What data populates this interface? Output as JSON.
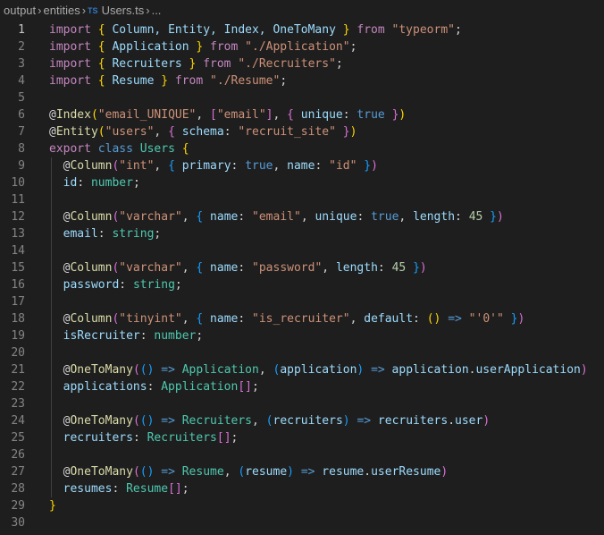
{
  "breadcrumb": {
    "items": [
      "output",
      "entities",
      "Users.ts",
      "..."
    ],
    "file_icon": "TS"
  },
  "editor": {
    "active_line": 1,
    "theme_colors": {
      "keyword_blue": "#569cd6",
      "keyword_purple": "#c586c0",
      "string": "#ce9178",
      "number": "#b5cea8",
      "type_teal": "#4ec9b0",
      "variable": "#9cdcfe",
      "function": "#dcdcaa",
      "bracket_gold": "#ffd700",
      "bracket_purple": "#da70d6",
      "bracket_blue": "#179fff",
      "text": "#d4d4d4",
      "line_number": "#858585"
    },
    "lines": [
      {
        "num": "1",
        "tokens": [
          [
            "import",
            "#c586c0"
          ],
          [
            " ",
            "#d4d4d4"
          ],
          [
            "{",
            "#ffd700"
          ],
          [
            " Column, Entity, Index, OneToMany ",
            "#9cdcfe"
          ],
          [
            "}",
            "#ffd700"
          ],
          [
            " ",
            "#d4d4d4"
          ],
          [
            "from",
            "#c586c0"
          ],
          [
            " ",
            "#d4d4d4"
          ],
          [
            "\"typeorm\"",
            "#ce9178"
          ],
          [
            ";",
            "#d4d4d4"
          ]
        ]
      },
      {
        "num": "2",
        "tokens": [
          [
            "import",
            "#c586c0"
          ],
          [
            " ",
            "#d4d4d4"
          ],
          [
            "{",
            "#ffd700"
          ],
          [
            " Application ",
            "#9cdcfe"
          ],
          [
            "}",
            "#ffd700"
          ],
          [
            " ",
            "#d4d4d4"
          ],
          [
            "from",
            "#c586c0"
          ],
          [
            " ",
            "#d4d4d4"
          ],
          [
            "\"./Application\"",
            "#ce9178"
          ],
          [
            ";",
            "#d4d4d4"
          ]
        ]
      },
      {
        "num": "3",
        "tokens": [
          [
            "import",
            "#c586c0"
          ],
          [
            " ",
            "#d4d4d4"
          ],
          [
            "{",
            "#ffd700"
          ],
          [
            " Recruiters ",
            "#9cdcfe"
          ],
          [
            "}",
            "#ffd700"
          ],
          [
            " ",
            "#d4d4d4"
          ],
          [
            "from",
            "#c586c0"
          ],
          [
            " ",
            "#d4d4d4"
          ],
          [
            "\"./Recruiters\"",
            "#ce9178"
          ],
          [
            ";",
            "#d4d4d4"
          ]
        ]
      },
      {
        "num": "4",
        "tokens": [
          [
            "import",
            "#c586c0"
          ],
          [
            " ",
            "#d4d4d4"
          ],
          [
            "{",
            "#ffd700"
          ],
          [
            " Resume ",
            "#9cdcfe"
          ],
          [
            "}",
            "#ffd700"
          ],
          [
            " ",
            "#d4d4d4"
          ],
          [
            "from",
            "#c586c0"
          ],
          [
            " ",
            "#d4d4d4"
          ],
          [
            "\"./Resume\"",
            "#ce9178"
          ],
          [
            ";",
            "#d4d4d4"
          ]
        ]
      },
      {
        "num": "5",
        "tokens": []
      },
      {
        "num": "6",
        "tokens": [
          [
            "@",
            "#d4d4d4"
          ],
          [
            "Index",
            "#dcdcaa"
          ],
          [
            "(",
            "#ffd700"
          ],
          [
            "\"email_UNIQUE\"",
            "#ce9178"
          ],
          [
            ", ",
            "#d4d4d4"
          ],
          [
            "[",
            "#da70d6"
          ],
          [
            "\"email\"",
            "#ce9178"
          ],
          [
            "]",
            "#da70d6"
          ],
          [
            ", ",
            "#d4d4d4"
          ],
          [
            "{",
            "#da70d6"
          ],
          [
            " ",
            "#d4d4d4"
          ],
          [
            "unique",
            "#9cdcfe"
          ],
          [
            ": ",
            "#d4d4d4"
          ],
          [
            "true",
            "#569cd6"
          ],
          [
            " ",
            "#d4d4d4"
          ],
          [
            "}",
            "#da70d6"
          ],
          [
            ")",
            "#ffd700"
          ]
        ]
      },
      {
        "num": "7",
        "tokens": [
          [
            "@",
            "#d4d4d4"
          ],
          [
            "Entity",
            "#dcdcaa"
          ],
          [
            "(",
            "#ffd700"
          ],
          [
            "\"users\"",
            "#ce9178"
          ],
          [
            ", ",
            "#d4d4d4"
          ],
          [
            "{",
            "#da70d6"
          ],
          [
            " ",
            "#d4d4d4"
          ],
          [
            "schema",
            "#9cdcfe"
          ],
          [
            ": ",
            "#d4d4d4"
          ],
          [
            "\"recruit_site\"",
            "#ce9178"
          ],
          [
            " ",
            "#d4d4d4"
          ],
          [
            "}",
            "#da70d6"
          ],
          [
            ")",
            "#ffd700"
          ]
        ]
      },
      {
        "num": "8",
        "tokens": [
          [
            "export",
            "#c586c0"
          ],
          [
            " ",
            "#d4d4d4"
          ],
          [
            "class",
            "#569cd6"
          ],
          [
            " ",
            "#d4d4d4"
          ],
          [
            "Users",
            "#4ec9b0"
          ],
          [
            " ",
            "#d4d4d4"
          ],
          [
            "{",
            "#ffd700"
          ]
        ]
      },
      {
        "num": "9",
        "tokens": [
          [
            "  @",
            "#d4d4d4"
          ],
          [
            "Column",
            "#dcdcaa"
          ],
          [
            "(",
            "#da70d6"
          ],
          [
            "\"int\"",
            "#ce9178"
          ],
          [
            ", ",
            "#d4d4d4"
          ],
          [
            "{",
            "#179fff"
          ],
          [
            " ",
            "#d4d4d4"
          ],
          [
            "primary",
            "#9cdcfe"
          ],
          [
            ": ",
            "#d4d4d4"
          ],
          [
            "true",
            "#569cd6"
          ],
          [
            ", ",
            "#d4d4d4"
          ],
          [
            "name",
            "#9cdcfe"
          ],
          [
            ": ",
            "#d4d4d4"
          ],
          [
            "\"id\"",
            "#ce9178"
          ],
          [
            " ",
            "#d4d4d4"
          ],
          [
            "}",
            "#179fff"
          ],
          [
            ")",
            "#da70d6"
          ]
        ]
      },
      {
        "num": "10",
        "tokens": [
          [
            "  ",
            "#d4d4d4"
          ],
          [
            "id",
            "#9cdcfe"
          ],
          [
            ": ",
            "#d4d4d4"
          ],
          [
            "number",
            "#4ec9b0"
          ],
          [
            ";",
            "#d4d4d4"
          ]
        ]
      },
      {
        "num": "11",
        "tokens": []
      },
      {
        "num": "12",
        "tokens": [
          [
            "  @",
            "#d4d4d4"
          ],
          [
            "Column",
            "#dcdcaa"
          ],
          [
            "(",
            "#da70d6"
          ],
          [
            "\"varchar\"",
            "#ce9178"
          ],
          [
            ", ",
            "#d4d4d4"
          ],
          [
            "{",
            "#179fff"
          ],
          [
            " ",
            "#d4d4d4"
          ],
          [
            "name",
            "#9cdcfe"
          ],
          [
            ": ",
            "#d4d4d4"
          ],
          [
            "\"email\"",
            "#ce9178"
          ],
          [
            ", ",
            "#d4d4d4"
          ],
          [
            "unique",
            "#9cdcfe"
          ],
          [
            ": ",
            "#d4d4d4"
          ],
          [
            "true",
            "#569cd6"
          ],
          [
            ", ",
            "#d4d4d4"
          ],
          [
            "length",
            "#9cdcfe"
          ],
          [
            ": ",
            "#d4d4d4"
          ],
          [
            "45",
            "#b5cea8"
          ],
          [
            " ",
            "#d4d4d4"
          ],
          [
            "}",
            "#179fff"
          ],
          [
            ")",
            "#da70d6"
          ]
        ]
      },
      {
        "num": "13",
        "tokens": [
          [
            "  ",
            "#d4d4d4"
          ],
          [
            "email",
            "#9cdcfe"
          ],
          [
            ": ",
            "#d4d4d4"
          ],
          [
            "string",
            "#4ec9b0"
          ],
          [
            ";",
            "#d4d4d4"
          ]
        ]
      },
      {
        "num": "14",
        "tokens": []
      },
      {
        "num": "15",
        "tokens": [
          [
            "  @",
            "#d4d4d4"
          ],
          [
            "Column",
            "#dcdcaa"
          ],
          [
            "(",
            "#da70d6"
          ],
          [
            "\"varchar\"",
            "#ce9178"
          ],
          [
            ", ",
            "#d4d4d4"
          ],
          [
            "{",
            "#179fff"
          ],
          [
            " ",
            "#d4d4d4"
          ],
          [
            "name",
            "#9cdcfe"
          ],
          [
            ": ",
            "#d4d4d4"
          ],
          [
            "\"password\"",
            "#ce9178"
          ],
          [
            ", ",
            "#d4d4d4"
          ],
          [
            "length",
            "#9cdcfe"
          ],
          [
            ": ",
            "#d4d4d4"
          ],
          [
            "45",
            "#b5cea8"
          ],
          [
            " ",
            "#d4d4d4"
          ],
          [
            "}",
            "#179fff"
          ],
          [
            ")",
            "#da70d6"
          ]
        ]
      },
      {
        "num": "16",
        "tokens": [
          [
            "  ",
            "#d4d4d4"
          ],
          [
            "password",
            "#9cdcfe"
          ],
          [
            ": ",
            "#d4d4d4"
          ],
          [
            "string",
            "#4ec9b0"
          ],
          [
            ";",
            "#d4d4d4"
          ]
        ]
      },
      {
        "num": "17",
        "tokens": []
      },
      {
        "num": "18",
        "tokens": [
          [
            "  @",
            "#d4d4d4"
          ],
          [
            "Column",
            "#dcdcaa"
          ],
          [
            "(",
            "#da70d6"
          ],
          [
            "\"tinyint\"",
            "#ce9178"
          ],
          [
            ", ",
            "#d4d4d4"
          ],
          [
            "{",
            "#179fff"
          ],
          [
            " ",
            "#d4d4d4"
          ],
          [
            "name",
            "#9cdcfe"
          ],
          [
            ": ",
            "#d4d4d4"
          ],
          [
            "\"is_recruiter\"",
            "#ce9178"
          ],
          [
            ", ",
            "#d4d4d4"
          ],
          [
            "default",
            "#9cdcfe"
          ],
          [
            ": ",
            "#d4d4d4"
          ],
          [
            "()",
            "#ffd700"
          ],
          [
            " ",
            "#d4d4d4"
          ],
          [
            "=>",
            "#569cd6"
          ],
          [
            " ",
            "#d4d4d4"
          ],
          [
            "\"'0'\"",
            "#ce9178"
          ],
          [
            " ",
            "#d4d4d4"
          ],
          [
            "}",
            "#179fff"
          ],
          [
            ")",
            "#da70d6"
          ]
        ]
      },
      {
        "num": "19",
        "tokens": [
          [
            "  ",
            "#d4d4d4"
          ],
          [
            "isRecruiter",
            "#9cdcfe"
          ],
          [
            ": ",
            "#d4d4d4"
          ],
          [
            "number",
            "#4ec9b0"
          ],
          [
            ";",
            "#d4d4d4"
          ]
        ]
      },
      {
        "num": "20",
        "tokens": []
      },
      {
        "num": "21",
        "tokens": [
          [
            "  @",
            "#d4d4d4"
          ],
          [
            "OneToMany",
            "#dcdcaa"
          ],
          [
            "(",
            "#da70d6"
          ],
          [
            "()",
            "#179fff"
          ],
          [
            " ",
            "#d4d4d4"
          ],
          [
            "=>",
            "#569cd6"
          ],
          [
            " ",
            "#d4d4d4"
          ],
          [
            "Application",
            "#4ec9b0"
          ],
          [
            ", ",
            "#d4d4d4"
          ],
          [
            "(",
            "#179fff"
          ],
          [
            "application",
            "#9cdcfe"
          ],
          [
            ")",
            "#179fff"
          ],
          [
            " ",
            "#d4d4d4"
          ],
          [
            "=>",
            "#569cd6"
          ],
          [
            " ",
            "#d4d4d4"
          ],
          [
            "application",
            "#9cdcfe"
          ],
          [
            ".",
            "#d4d4d4"
          ],
          [
            "userApplication",
            "#9cdcfe"
          ],
          [
            ")",
            "#da70d6"
          ]
        ]
      },
      {
        "num": "22",
        "tokens": [
          [
            "  ",
            "#d4d4d4"
          ],
          [
            "applications",
            "#9cdcfe"
          ],
          [
            ": ",
            "#d4d4d4"
          ],
          [
            "Application",
            "#4ec9b0"
          ],
          [
            "[]",
            "#da70d6"
          ],
          [
            ";",
            "#d4d4d4"
          ]
        ]
      },
      {
        "num": "23",
        "tokens": []
      },
      {
        "num": "24",
        "tokens": [
          [
            "  @",
            "#d4d4d4"
          ],
          [
            "OneToMany",
            "#dcdcaa"
          ],
          [
            "(",
            "#da70d6"
          ],
          [
            "()",
            "#179fff"
          ],
          [
            " ",
            "#d4d4d4"
          ],
          [
            "=>",
            "#569cd6"
          ],
          [
            " ",
            "#d4d4d4"
          ],
          [
            "Recruiters",
            "#4ec9b0"
          ],
          [
            ", ",
            "#d4d4d4"
          ],
          [
            "(",
            "#179fff"
          ],
          [
            "recruiters",
            "#9cdcfe"
          ],
          [
            ")",
            "#179fff"
          ],
          [
            " ",
            "#d4d4d4"
          ],
          [
            "=>",
            "#569cd6"
          ],
          [
            " ",
            "#d4d4d4"
          ],
          [
            "recruiters",
            "#9cdcfe"
          ],
          [
            ".",
            "#d4d4d4"
          ],
          [
            "user",
            "#9cdcfe"
          ],
          [
            ")",
            "#da70d6"
          ]
        ]
      },
      {
        "num": "25",
        "tokens": [
          [
            "  ",
            "#d4d4d4"
          ],
          [
            "recruiters",
            "#9cdcfe"
          ],
          [
            ": ",
            "#d4d4d4"
          ],
          [
            "Recruiters",
            "#4ec9b0"
          ],
          [
            "[]",
            "#da70d6"
          ],
          [
            ";",
            "#d4d4d4"
          ]
        ]
      },
      {
        "num": "26",
        "tokens": []
      },
      {
        "num": "27",
        "tokens": [
          [
            "  @",
            "#d4d4d4"
          ],
          [
            "OneToMany",
            "#dcdcaa"
          ],
          [
            "(",
            "#da70d6"
          ],
          [
            "()",
            "#179fff"
          ],
          [
            " ",
            "#d4d4d4"
          ],
          [
            "=>",
            "#569cd6"
          ],
          [
            " ",
            "#d4d4d4"
          ],
          [
            "Resume",
            "#4ec9b0"
          ],
          [
            ", ",
            "#d4d4d4"
          ],
          [
            "(",
            "#179fff"
          ],
          [
            "resume",
            "#9cdcfe"
          ],
          [
            ")",
            "#179fff"
          ],
          [
            " ",
            "#d4d4d4"
          ],
          [
            "=>",
            "#569cd6"
          ],
          [
            " ",
            "#d4d4d4"
          ],
          [
            "resume",
            "#9cdcfe"
          ],
          [
            ".",
            "#d4d4d4"
          ],
          [
            "userResume",
            "#9cdcfe"
          ],
          [
            ")",
            "#da70d6"
          ]
        ]
      },
      {
        "num": "28",
        "tokens": [
          [
            "  ",
            "#d4d4d4"
          ],
          [
            "resumes",
            "#9cdcfe"
          ],
          [
            ": ",
            "#d4d4d4"
          ],
          [
            "Resume",
            "#4ec9b0"
          ],
          [
            "[]",
            "#da70d6"
          ],
          [
            ";",
            "#d4d4d4"
          ]
        ]
      },
      {
        "num": "29",
        "tokens": [
          [
            "}",
            "#ffd700"
          ]
        ]
      },
      {
        "num": "30",
        "tokens": []
      }
    ]
  }
}
